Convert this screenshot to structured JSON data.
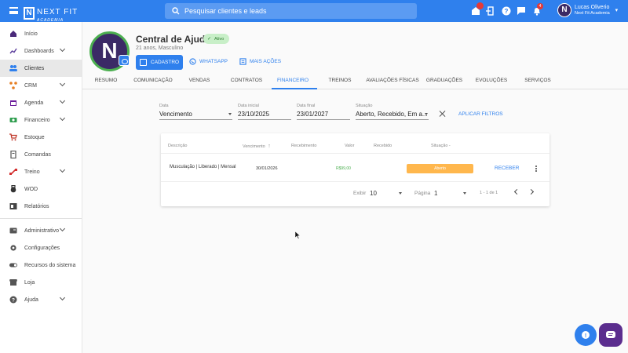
{
  "topbar": {
    "logo": "NEXT FIT",
    "logo_sub": "ACADEMIA",
    "search_placeholder": "Pesquisar clientes e leads",
    "notif_count": "4",
    "user_name": "Lucas Oliverio",
    "user_company": "Next Fit Academia"
  },
  "sidebar": {
    "items": [
      {
        "label": "Início",
        "icon": "home-icon",
        "color": "#4b2a7a",
        "chevron": false
      },
      {
        "label": "Dashboards",
        "icon": "chart-icon",
        "color": "#5b3d9b",
        "chevron": true
      },
      {
        "label": "Clientes",
        "icon": "people-icon",
        "color": "#2f80ed",
        "chevron": false,
        "active": true
      },
      {
        "label": "CRM",
        "icon": "crm-icon",
        "color": "#e67e22",
        "chevron": true
      },
      {
        "label": "Agenda",
        "icon": "calendar-icon",
        "color": "#6a1b9a",
        "chevron": true
      },
      {
        "label": "Financeiro",
        "icon": "money-icon",
        "color": "#2e9d4e",
        "chevron": true
      },
      {
        "label": "Estoque",
        "icon": "cart-icon",
        "color": "#c0392b",
        "chevron": false
      },
      {
        "label": "Comandas",
        "icon": "receipt-icon",
        "color": "#555555",
        "chevron": false
      },
      {
        "label": "Treino",
        "icon": "dumbbell-icon",
        "color": "#d32f2f",
        "chevron": true
      },
      {
        "label": "WOD",
        "icon": "kettlebell-icon",
        "color": "#333333",
        "chevron": false
      },
      {
        "label": "Relatórios",
        "icon": "report-icon",
        "color": "#444444",
        "chevron": false
      }
    ],
    "bottom_items": [
      {
        "label": "Administrativo",
        "icon": "id-card-icon",
        "chevron": true
      },
      {
        "label": "Configurações",
        "icon": "gear-icon",
        "chevron": false
      },
      {
        "label": "Recursos do sistema",
        "icon": "toggle-icon",
        "chevron": false
      },
      {
        "label": "Loja",
        "icon": "store-icon",
        "chevron": false
      },
      {
        "label": "Ajuda",
        "icon": "help-icon",
        "chevron": true
      }
    ]
  },
  "profile": {
    "name": "Central de Ajuda",
    "status": "Ativo",
    "info": "21 anos, Masculino",
    "btn_cadastro": "CADASTRO",
    "btn_whatsapp": "WHATSAPP",
    "btn_more": "MAIS AÇÕES"
  },
  "tabs": [
    "RESUMO",
    "COMUNICAÇÃO",
    "VENDAS",
    "CONTRATOS",
    "FINANCEIRO",
    "TREINOS",
    "AVALIAÇÕES FÍSICAS",
    "GRADUAÇÕES",
    "EVOLUÇÕES",
    "SERVIÇOS"
  ],
  "active_tab": "FINANCEIRO",
  "filters": {
    "data": {
      "label": "Data",
      "value": "Vencimento"
    },
    "inicial": {
      "label": "Data inicial",
      "value": "23/10/2025"
    },
    "final": {
      "label": "Data final",
      "value": "23/01/2027"
    },
    "situacao": {
      "label": "Situação",
      "value": "Aberto, Recebido, Em a..."
    },
    "apply": "APLICAR FILTROS"
  },
  "table": {
    "headers": {
      "descricao": "Descrição",
      "vencimento": "Vencimento",
      "recebimento": "Recebimento",
      "valor": "Valor",
      "recebido": "Recebido",
      "situacao": "Situação"
    },
    "rows": [
      {
        "descricao": "Musculação | Liberado | Mensal",
        "vencimento": "30/01/2026",
        "valor": "R$99,00",
        "situacao": "Aberto",
        "action": "RECEBER"
      }
    ]
  },
  "pagination": {
    "exibir_label": "Exibir",
    "exibir_value": "10",
    "pagina_label": "Página",
    "pagina_value": "1",
    "range": "1 - 1 de 1"
  },
  "colors": {
    "primary": "#2f80ed",
    "aberto": "#ffb74d",
    "chat": "#5b2d8e"
  }
}
